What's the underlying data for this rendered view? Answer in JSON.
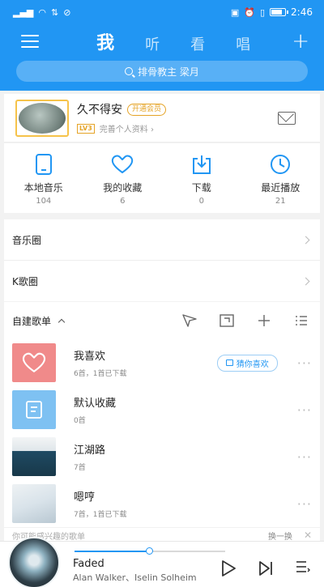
{
  "status_bar": {
    "left_icons": [
      "signal-icon",
      "wifi-icon",
      "data-icon",
      "blocked-icon"
    ],
    "right_icons": [
      "battery-saver-icon",
      "alarm-icon",
      "vibrate-icon"
    ],
    "time": "2:46",
    "battery_level": 0.85
  },
  "header": {
    "tabs": [
      {
        "label": "我",
        "active": true
      },
      {
        "label": "听",
        "active": false
      },
      {
        "label": "看",
        "active": false
      },
      {
        "label": "唱",
        "active": false
      }
    ],
    "plus_label": "+",
    "search_placeholder": "排骨教主 梁月"
  },
  "profile": {
    "nickname": "久不得安",
    "vip_badge": "开通会员",
    "level_badge": "LV3",
    "edit_text": "完善个人资料",
    "edit_arrow": "›"
  },
  "stats": [
    {
      "label": "本地音乐",
      "count": "104",
      "icon": "phone-icon"
    },
    {
      "label": "我的收藏",
      "count": "6",
      "icon": "heart-icon"
    },
    {
      "label": "下载",
      "count": "0",
      "icon": "download-icon"
    },
    {
      "label": "最近播放",
      "count": "21",
      "icon": "clock-icon"
    }
  ],
  "rows": [
    {
      "label": "音乐圈"
    },
    {
      "label": "K歌圈"
    }
  ],
  "playlists_header": {
    "title": "自建歌单",
    "actions": [
      "send-icon",
      "import-icon",
      "add-icon",
      "manage-icon"
    ]
  },
  "playlists": [
    {
      "title": "我喜欢",
      "meta": "6首，1首已下载",
      "has_guess": true,
      "guess_label": "猜你喜欢",
      "cover_color": "#f08a8a"
    },
    {
      "title": "默认收藏",
      "meta": "0首",
      "has_guess": false,
      "cover_color": "#7ec1f2"
    },
    {
      "title": "江湖路",
      "meta": "7首",
      "has_guess": false,
      "cover_color": "#1f4a63"
    },
    {
      "title": "嗯哼",
      "meta": "7首，1首已下载",
      "has_guess": false,
      "cover_color": "#d9e3ea"
    }
  ],
  "recommend": {
    "text": "你可能感兴趣的歌单",
    "swap": "换一换",
    "close": "✕"
  },
  "player": {
    "song": "Faded",
    "artist": "Alan Walker、Iselin Solheim",
    "progress": 0.5
  },
  "colors": {
    "brand": "#2196f3",
    "vip": "#e5a326"
  }
}
